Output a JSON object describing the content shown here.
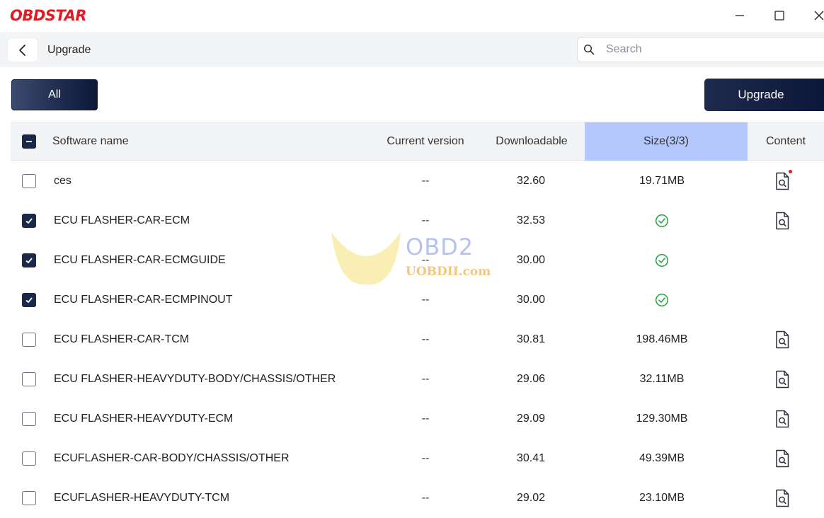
{
  "app": {
    "logo_text": "OBDSTAR",
    "brand_color": "#e11b22"
  },
  "window_controls": {
    "minimize_icon": "minimize-icon",
    "maximize_icon": "maximize-icon",
    "close_icon": "close-icon"
  },
  "header": {
    "title": "Upgrade",
    "search": {
      "placeholder": "Search",
      "value": ""
    }
  },
  "toolbar": {
    "filter_all_label": "All",
    "upgrade_label": "Upgrade"
  },
  "table": {
    "columns": {
      "name": "Software name",
      "current": "Current version",
      "downloadable": "Downloadable",
      "size": "Size(3/3)",
      "content": "Content"
    },
    "header_checkbox_state": "partial",
    "rows": [
      {
        "checked": false,
        "name": "ces",
        "current": "--",
        "downloadable": "32.60",
        "size": "19.71MB",
        "size_done": false,
        "has_content": true,
        "content_new": true
      },
      {
        "checked": true,
        "name": "ECU FLASHER-CAR-ECM",
        "current": "--",
        "downloadable": "32.53",
        "size": "",
        "size_done": true,
        "has_content": true,
        "content_new": false
      },
      {
        "checked": true,
        "name": "ECU FLASHER-CAR-ECMGUIDE",
        "current": "--",
        "downloadable": "30.00",
        "size": "",
        "size_done": true,
        "has_content": false,
        "content_new": false
      },
      {
        "checked": true,
        "name": "ECU FLASHER-CAR-ECMPINOUT",
        "current": "--",
        "downloadable": "30.00",
        "size": "",
        "size_done": true,
        "has_content": false,
        "content_new": false
      },
      {
        "checked": false,
        "name": "ECU FLASHER-CAR-TCM",
        "current": "--",
        "downloadable": "30.81",
        "size": "198.46MB",
        "size_done": false,
        "has_content": true,
        "content_new": false
      },
      {
        "checked": false,
        "name": "ECU FLASHER-HEAVYDUTY-BODY/CHASSIS/OTHER",
        "current": "--",
        "downloadable": "29.06",
        "size": "32.11MB",
        "size_done": false,
        "has_content": true,
        "content_new": false
      },
      {
        "checked": false,
        "name": "ECU FLASHER-HEAVYDUTY-ECM",
        "current": "--",
        "downloadable": "29.09",
        "size": "129.30MB",
        "size_done": false,
        "has_content": true,
        "content_new": false
      },
      {
        "checked": false,
        "name": "ECUFLASHER-CAR-BODY/CHASSIS/OTHER",
        "current": "--",
        "downloadable": "30.41",
        "size": "49.39MB",
        "size_done": false,
        "has_content": true,
        "content_new": false
      },
      {
        "checked": false,
        "name": "ECUFLASHER-HEAVYDUTY-TCM",
        "current": "--",
        "downloadable": "29.02",
        "size": "23.10MB",
        "size_done": false,
        "has_content": true,
        "content_new": false
      }
    ]
  },
  "watermark": {
    "title": "OBD2",
    "url": "UOBDII.com"
  },
  "colors": {
    "accent_dark": "#1c2849",
    "size_header_bg": "#b3c7fb",
    "success_green": "#2ea84a"
  }
}
